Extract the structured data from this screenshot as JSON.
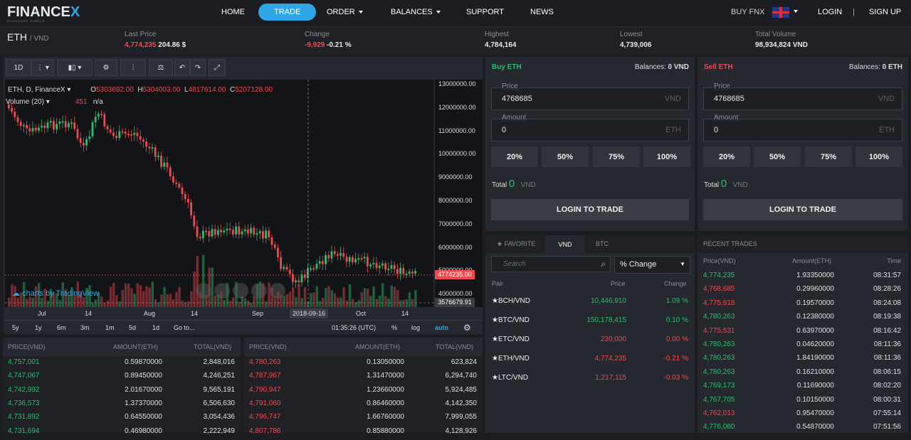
{
  "nav": {
    "logo": "FINANCEX",
    "logo_sub": "EXCHANGE SIMPLE",
    "items": [
      "HOME",
      "TRADE",
      "ORDER",
      "BALANCES",
      "SUPPORT",
      "NEWS"
    ],
    "buy_fnx": "BUY FNX",
    "login": "LOGIN",
    "sep": "|",
    "signup": "SIGN UP"
  },
  "pair": {
    "base": "ETH",
    "quote": "/ VND"
  },
  "ticker": {
    "last_price_label": "Last Price",
    "last_price": "4,774,235",
    "last_price_usd": "204.86 $",
    "change_label": "Change",
    "change": "-9,929",
    "change_pct": "-0.21 %",
    "high_label": "Highest",
    "high": "4,784,164",
    "low_label": "Lowest",
    "low": "4,739,006",
    "vol_label": "Total Volume",
    "vol": "98,934,824 VND"
  },
  "chart": {
    "interval": "1D",
    "legend_symbol": "ETH, D, FinanceX",
    "o_label": "O",
    "o": "5303692.00",
    "h_label": "H",
    "h": "5304003.00",
    "l_label": "L",
    "l": "4817614.00",
    "c_label": "C",
    "c": "5207128.00",
    "volume_label": "Volume (20)",
    "volume_val": "451",
    "volume_na": "n/a",
    "watermark": "charts by TradingView",
    "price_ticks": [
      "13000000.00",
      "12000000.00",
      "11000000.00",
      "10000000.00",
      "9000000.00",
      "8000000.00",
      "7000000.00",
      "6000000.00",
      "5000000.00",
      "4000000.00"
    ],
    "current_price": "4774235.00",
    "cursor_price": "3576679.91",
    "x_ticks": [
      "Jul",
      "14",
      "Aug",
      "14",
      "Sep",
      "Oct",
      "14"
    ],
    "cursor_date": "2018-09-16",
    "ranges": [
      "5y",
      "1y",
      "6m",
      "3m",
      "1m",
      "5d",
      "1d",
      "Go to..."
    ],
    "time": "01:35:26 (UTC)",
    "pct": "%",
    "log": "log",
    "auto": "auto"
  },
  "buy": {
    "title": "Buy ETH",
    "balances_label": "Balances:",
    "balance": "0 VND",
    "price_label": "Price",
    "price": "4768685",
    "price_unit": "VND",
    "amount_label": "Amount",
    "amount": "0",
    "amount_unit": "ETH",
    "pcts": [
      "20%",
      "50%",
      "75%",
      "100%"
    ],
    "total_label": "Total",
    "total": "0",
    "total_unit": "VND",
    "login": "LOGIN TO TRADE"
  },
  "sell": {
    "title": "Sell ETH",
    "balances_label": "Balances:",
    "balance": "0 ETH",
    "price_label": "Price",
    "price": "4768685",
    "price_unit": "VND",
    "amount_label": "Amount",
    "amount": "0",
    "amount_unit": "ETH",
    "pcts": [
      "20%",
      "50%",
      "75%",
      "100%"
    ],
    "total_label": "Total",
    "total": "0",
    "total_unit": "VND",
    "login": "LOGIN TO TRADE"
  },
  "market": {
    "tabs": [
      "FAVORITE",
      "VND",
      "BTC"
    ],
    "search_placeholder": "Search",
    "sort": "% Change",
    "headers": [
      "Pair",
      "Price",
      "Change"
    ],
    "rows": [
      {
        "pair": "BCH/VND",
        "price": "10,446,910",
        "change": "1.09 %",
        "dir": "up"
      },
      {
        "pair": "BTC/VND",
        "price": "150,178,415",
        "change": "0.10 %",
        "dir": "up"
      },
      {
        "pair": "ETC/VND",
        "price": "230,000",
        "change": "0.00 %",
        "dir": "down"
      },
      {
        "pair": "ETH/VND",
        "price": "4,774,235",
        "change": "-0.21 %",
        "dir": "down"
      },
      {
        "pair": "LTC/VND",
        "price": "1,217,115",
        "change": "-0.03 %",
        "dir": "down"
      }
    ]
  },
  "recent": {
    "title": "RECENT TRADES",
    "headers": [
      "Price(VND)",
      "Amount(ETH)",
      "Time"
    ],
    "rows": [
      {
        "p": "4,774,235",
        "a": "1.93350000",
        "t": "08:31:57",
        "dir": "up"
      },
      {
        "p": "4,768,685",
        "a": "0.29960000",
        "t": "08:28:26",
        "dir": "down"
      },
      {
        "p": "4,775,918",
        "a": "0.19570000",
        "t": "08:24:08",
        "dir": "down"
      },
      {
        "p": "4,780,263",
        "a": "0.12380000",
        "t": "08:19:38",
        "dir": "up"
      },
      {
        "p": "4,775,531",
        "a": "0.63970000",
        "t": "08:16:42",
        "dir": "down"
      },
      {
        "p": "4,780,263",
        "a": "0.04620000",
        "t": "08:11:36",
        "dir": "up"
      },
      {
        "p": "4,780,263",
        "a": "1.84190000",
        "t": "08:11:36",
        "dir": "up"
      },
      {
        "p": "4,780,263",
        "a": "0.16210000",
        "t": "08:06:15",
        "dir": "up"
      },
      {
        "p": "4,769,173",
        "a": "0.11690000",
        "t": "08:02:20",
        "dir": "up"
      },
      {
        "p": "4,767,705",
        "a": "0.10150000",
        "t": "08:00:31",
        "dir": "up"
      },
      {
        "p": "4,762,013",
        "a": "0.95470000",
        "t": "07:55:14",
        "dir": "down"
      },
      {
        "p": "4,776,080",
        "a": "0.54870000",
        "t": "07:51:56",
        "dir": "up"
      }
    ]
  },
  "bids": {
    "headers": [
      "PRICE(VND)",
      "AMOUNT(ETH)",
      "TOTAL(VND)"
    ],
    "rows": [
      [
        "4,757,001",
        "0.59870000",
        "2,848,016"
      ],
      [
        "4,747,067",
        "0.89450000",
        "4,246,251"
      ],
      [
        "4,742,992",
        "2.01670000",
        "9,565,191"
      ],
      [
        "4,736,573",
        "1.37370000",
        "6,506,630"
      ],
      [
        "4,731,892",
        "0.64550000",
        "3,054,436"
      ],
      [
        "4,731,694",
        "0.46980000",
        "2,222,949"
      ]
    ]
  },
  "asks": {
    "headers": [
      "PRICE(VND)",
      "AMOUNT(ETH)",
      "TOTAL(VND)"
    ],
    "rows": [
      [
        "4,780,263",
        "0.13050000",
        "623,824"
      ],
      [
        "4,787,967",
        "1.31470000",
        "6,294,740"
      ],
      [
        "4,790,947",
        "1.23660000",
        "5,924,485"
      ],
      [
        "4,791,060",
        "0.86460000",
        "4,142,350"
      ],
      [
        "4,796,747",
        "1.66760000",
        "7,999,055"
      ],
      [
        "4,807,786",
        "0.85880000",
        "4,128,926"
      ]
    ]
  },
  "colors": {
    "up": "#2dbd6e",
    "down": "#f04a50",
    "accent": "#2ea6e6"
  }
}
